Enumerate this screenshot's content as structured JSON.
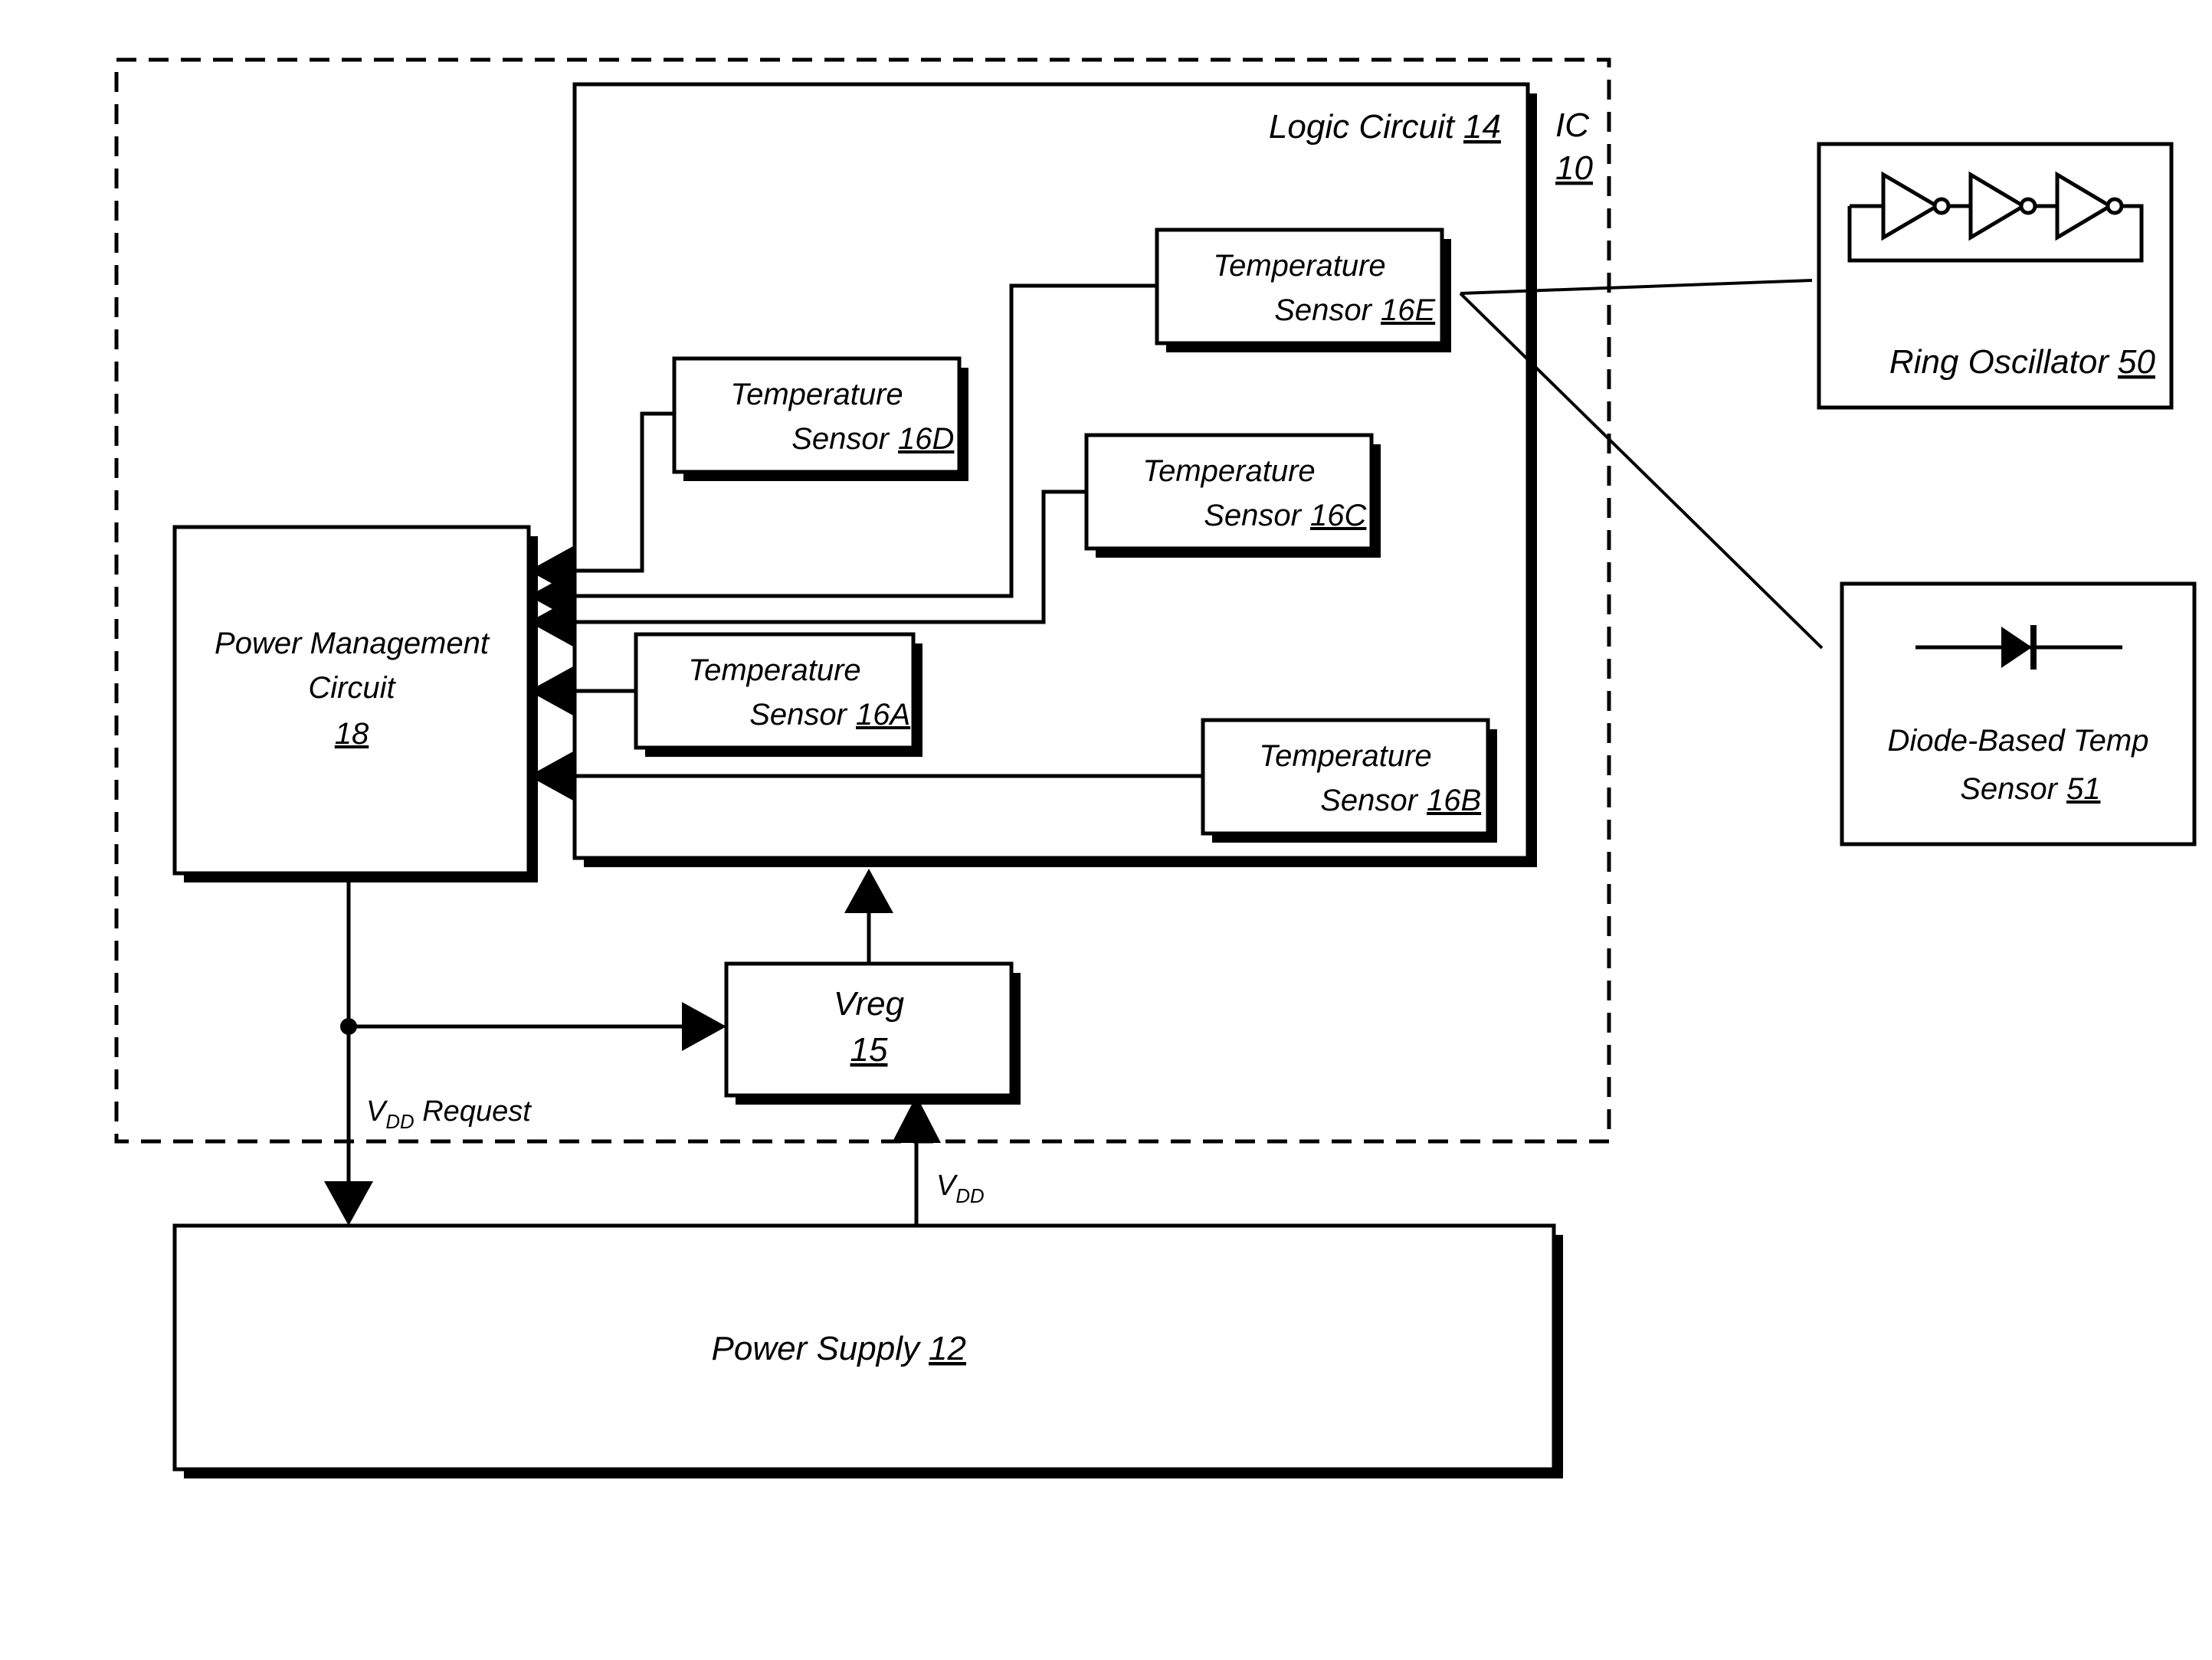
{
  "figure": {
    "ic": {
      "label": "IC",
      "ref": "10"
    },
    "logic_circuit": {
      "label": "Logic Circuit",
      "ref": "14"
    },
    "power_management": {
      "line1": "Power Management",
      "line2": "Circuit",
      "ref": "18"
    },
    "vreg": {
      "label": "Vreg",
      "ref": "15"
    },
    "power_supply": {
      "label": "Power Supply",
      "ref": "12"
    },
    "sensors": [
      {
        "id": "16A",
        "line1": "Temperature",
        "line2": "Sensor",
        "ref": "16A"
      },
      {
        "id": "16B",
        "line1": "Temperature",
        "line2": "Sensor",
        "ref": "16B"
      },
      {
        "id": "16C",
        "line1": "Temperature",
        "line2": "Sensor",
        "ref": "16C"
      },
      {
        "id": "16D",
        "line1": "Temperature",
        "line2": "Sensor",
        "ref": "16D"
      },
      {
        "id": "16E",
        "line1": "Temperature",
        "line2": "Sensor",
        "ref": "16E"
      }
    ],
    "callouts": [
      {
        "id": "ring-oscillator",
        "label": "Ring Oscillator",
        "ref": "50",
        "inverter_count": 3
      },
      {
        "id": "diode-temp-sensor",
        "line1": "Diode-Based Temp",
        "line2": "Sensor",
        "ref": "51"
      }
    ],
    "signals": [
      {
        "id": "vdd-request",
        "base": "V",
        "subscript": "DD",
        "rest": " Request"
      },
      {
        "id": "vdd",
        "base": "V",
        "subscript": "DD",
        "rest": ""
      }
    ],
    "colors": {
      "line": "#000000",
      "fill": "#ffffff"
    }
  }
}
